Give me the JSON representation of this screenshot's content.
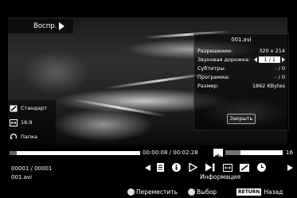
{
  "play_label": "Воспр.",
  "info_panel": {
    "title": "001.avi",
    "rows": [
      {
        "label": "Разрешение:",
        "value": "320 x 214"
      },
      {
        "label": "Звуковая дорожка:",
        "value": "1 / 1"
      },
      {
        "label": "Субтитры:",
        "value": "- / 0"
      },
      {
        "label": "Программа:",
        "value": "- / 0"
      },
      {
        "label": "Размер:",
        "value": "1862 KBytes"
      }
    ],
    "close_label": "Закрыть"
  },
  "view_options": [
    {
      "icon": "picture-mode-icon",
      "label": "Стандарт"
    },
    {
      "icon": "aspect-ratio-icon",
      "label": "16:9"
    },
    {
      "icon": "repeat-icon",
      "label": "Папка"
    }
  ],
  "playback": {
    "time": "00:00:08 / 00:02:28",
    "progress": 0.054,
    "volume_value": "16",
    "volume_level": 0.27,
    "counter": "00001 / 00001",
    "filename": "001.avi",
    "info_label": "Информация"
  },
  "controls": [
    "prev-icon",
    "document-icon",
    "info-icon",
    "play-icon",
    "next-icon",
    "aspect-icon",
    "picture-icon",
    "clock-icon",
    "scroll-right-icon"
  ],
  "footer": {
    "move_label": "Переместить",
    "select_label": "Выбор",
    "return_key": "RETURN",
    "back_label": "Назад"
  },
  "colors": {
    "background": "#000000",
    "panel": "#000000",
    "highlight": "#ffffff"
  }
}
